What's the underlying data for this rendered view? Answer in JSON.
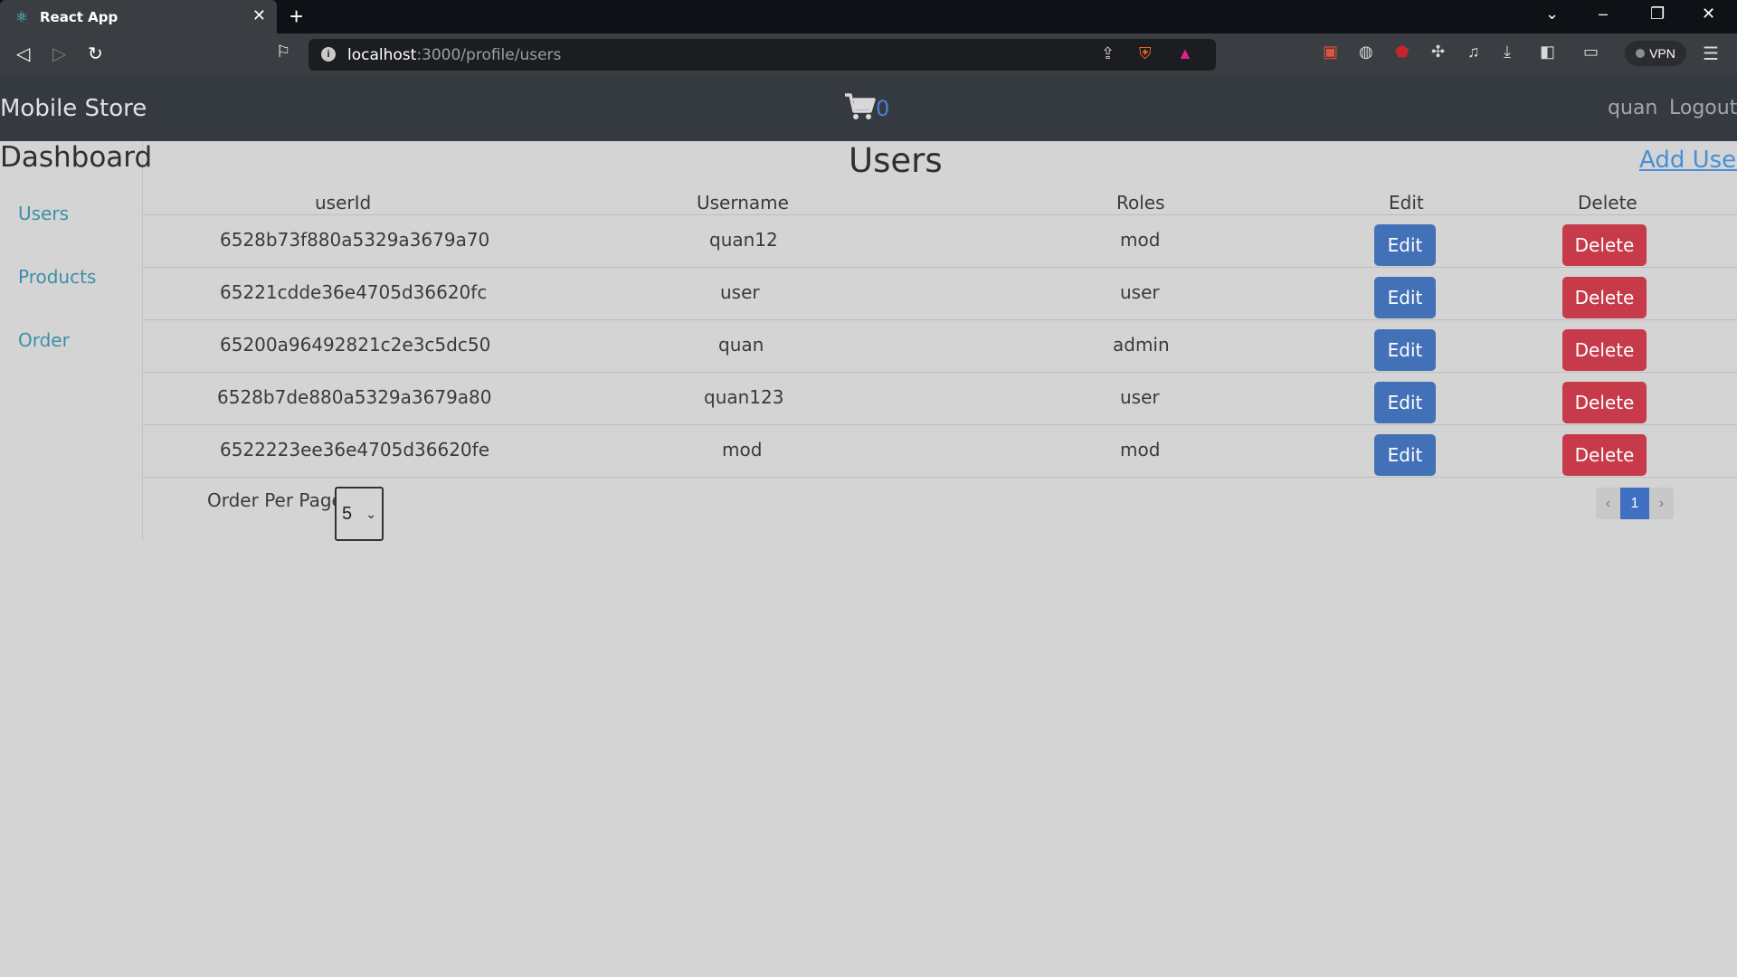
{
  "browser": {
    "tab_title": "React App",
    "url_host": "localhost",
    "url_path": ":3000/profile/users",
    "vpn_label": "VPN"
  },
  "navbar": {
    "brand": "Mobile Store",
    "cart_count": "0",
    "username": "quan",
    "logout": "Logout"
  },
  "sidebar": {
    "title": "Dashboard",
    "items": [
      {
        "label": "Users"
      },
      {
        "label": "Products"
      },
      {
        "label": "Order"
      }
    ]
  },
  "main": {
    "title": "Users",
    "add_user": "Add User"
  },
  "table": {
    "headers": [
      "userId",
      "Username",
      "Roles",
      "Edit",
      "Delete"
    ],
    "rows": [
      {
        "userId": "6528b73f880a5329a3679a70",
        "username": "quan12",
        "roles": "mod",
        "edit": "Edit",
        "delete": "Delete"
      },
      {
        "userId": "65221cdde36e4705d36620fc",
        "username": "user",
        "roles": "user",
        "edit": "Edit",
        "delete": "Delete"
      },
      {
        "userId": "65200a96492821c2e3c5dc50",
        "username": "quan",
        "roles": "admin",
        "edit": "Edit",
        "delete": "Delete"
      },
      {
        "userId": "6528b7de880a5329a3679a80",
        "username": "quan123",
        "roles": "user",
        "edit": "Edit",
        "delete": "Delete"
      },
      {
        "userId": "6522223ee36e4705d36620fe",
        "username": "mod",
        "roles": "mod",
        "edit": "Edit",
        "delete": "Delete"
      }
    ]
  },
  "pagination": {
    "per_page_label": "Order Per Page",
    "per_page_value": "5",
    "prev": "‹",
    "current": "1",
    "next": "›"
  }
}
